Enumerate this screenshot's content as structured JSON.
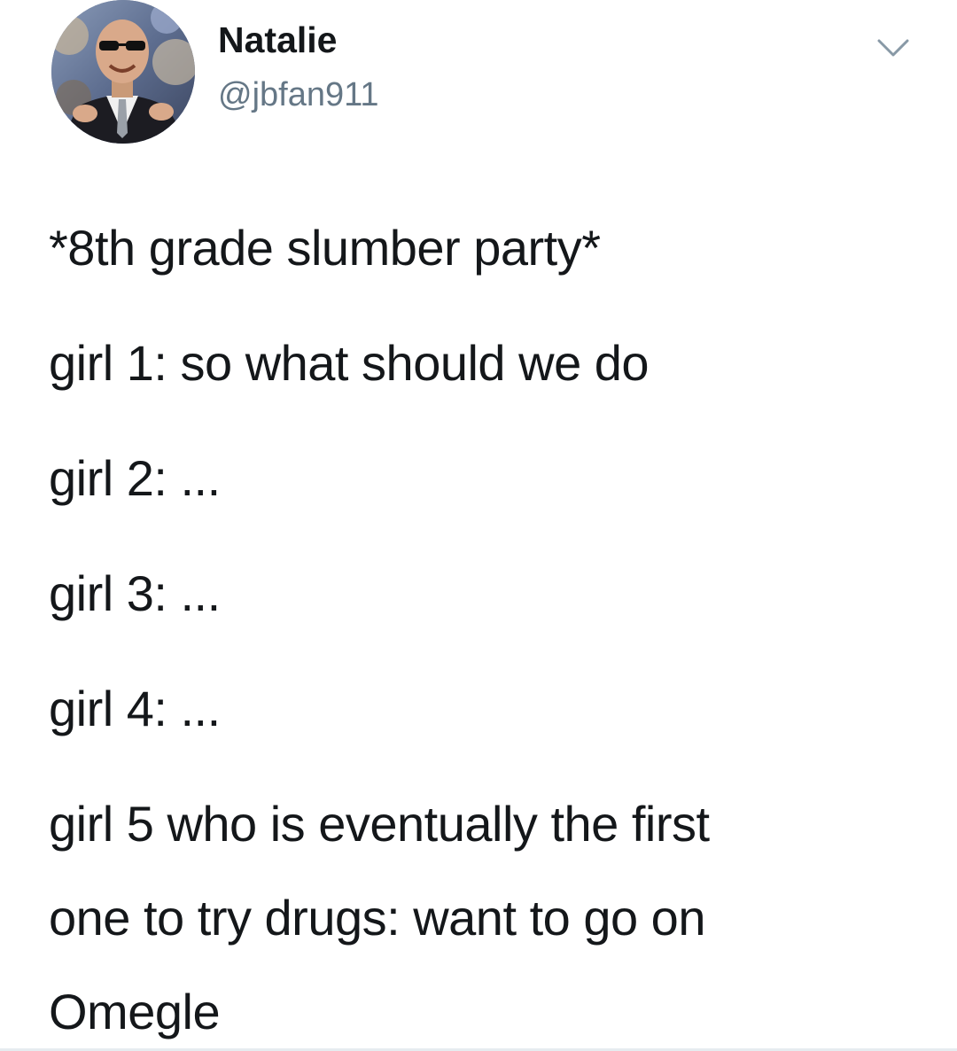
{
  "author": {
    "display_name": "Natalie",
    "handle": "@jbfan911",
    "avatar_icon": "profile-photo"
  },
  "menu": {
    "icon": "chevron-down-icon"
  },
  "tweet": {
    "lines": [
      "*8th grade slumber party*",
      "girl 1: so what should we do",
      "girl 2: ...",
      "girl 3: ...",
      "girl 4: ...",
      "girl 5 who is eventually the first",
      "one to try drugs: want to go on",
      "Omegle"
    ]
  },
  "colors": {
    "text": "#14171a",
    "secondary_text": "#657786",
    "background": "#ffffff"
  }
}
